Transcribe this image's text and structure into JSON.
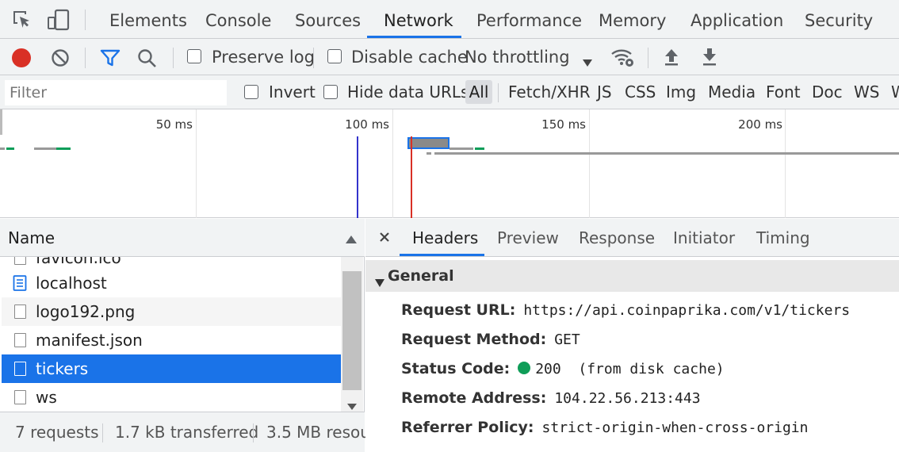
{
  "tabs": [
    "Elements",
    "Console",
    "Sources",
    "Network",
    "Performance",
    "Memory",
    "Application",
    "Security"
  ],
  "active_tab": "Network",
  "toolbar": {
    "preserve_log": "Preserve log",
    "disable_cache": "Disable cache",
    "throttling": "No throttling"
  },
  "filter": {
    "placeholder": "Filter",
    "invert": "Invert",
    "hide_data_urls": "Hide data URLs",
    "types": [
      "All",
      "Fetch/XHR",
      "JS",
      "CSS",
      "Img",
      "Media",
      "Font",
      "Doc",
      "WS",
      "W"
    ]
  },
  "overview": {
    "ticks": [
      "50 ms",
      "100 ms",
      "150 ms",
      "200 ms"
    ]
  },
  "requests": {
    "header": "Name",
    "rows": [
      "favicon.ico",
      "localhost",
      "logo192.png",
      "manifest.json",
      "tickers",
      "ws"
    ],
    "selected": "tickers"
  },
  "status": {
    "requests": "7 requests",
    "transferred": "1.7 kB transferred",
    "resources": "3.5 MB resou"
  },
  "detail": {
    "tabs": [
      "Headers",
      "Preview",
      "Response",
      "Initiator",
      "Timing"
    ],
    "active_tab": "Headers",
    "section_title": "General",
    "fields": [
      {
        "label": "Request URL:",
        "value": "https://api.coinpaprika.com/v1/tickers"
      },
      {
        "label": "Request Method:",
        "value": "GET"
      },
      {
        "label": "Status Code:",
        "value": "200  (from disk cache)"
      },
      {
        "label": "Remote Address:",
        "value": "104.22.56.213:443"
      },
      {
        "label": "Referrer Policy:",
        "value": "strict-origin-when-cross-origin"
      }
    ]
  },
  "colors": {
    "accent": "#1a73e8",
    "record": "#d93025",
    "status_ok": "#0f9d58"
  }
}
